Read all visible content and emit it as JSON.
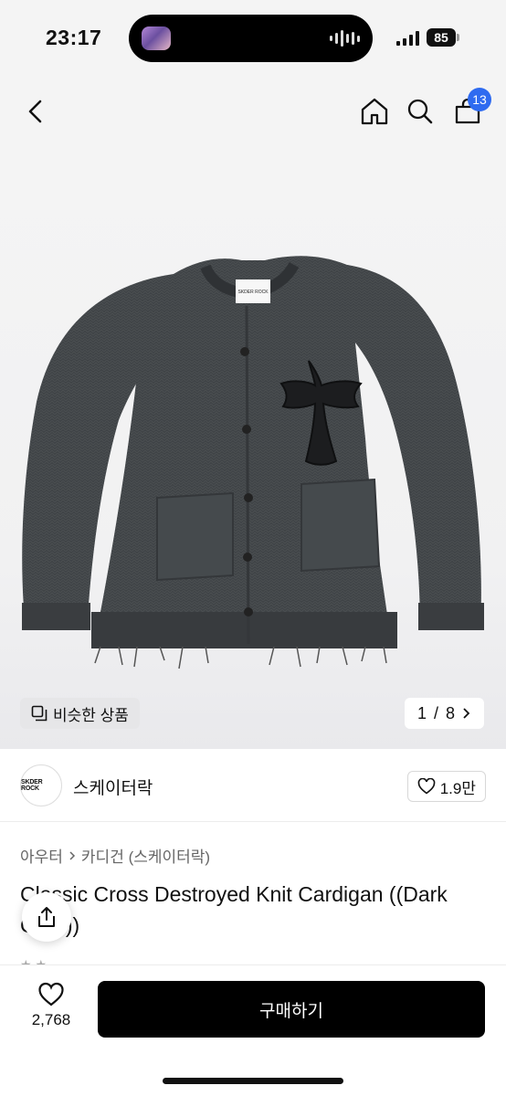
{
  "status_bar": {
    "time": "23:17",
    "battery": "85",
    "icons": [
      "now-playing-thumbnail-icon",
      "audio-wave-icon",
      "signal-icon",
      "battery-icon"
    ]
  },
  "nav": {
    "icons": [
      "back-icon",
      "home-icon",
      "search-icon",
      "cart-icon"
    ],
    "cart_count": "13"
  },
  "gallery": {
    "image_alt": "Dark gray distressed knit cardigan with black cross patch",
    "label_text": "SKDER ROCK",
    "similar_label": "비슷한 상품",
    "page_current": "1",
    "page_total": "8",
    "page_separator": "/"
  },
  "brand": {
    "logo_text": "SKDER ROCK",
    "name": "스케이터락",
    "likes": "1.9만"
  },
  "breadcrumb": {
    "category": "아우터",
    "subcategory": "카디건 (스케이터락)"
  },
  "product": {
    "title": "Classic Cross Destroyed Knit Cardigan ((Dark Gray))"
  },
  "bottom_bar": {
    "wish_count": "2,768",
    "buy_label": "구매하기"
  },
  "colors": {
    "accent_badge": "#2f6bf0",
    "buy_button": "#000000",
    "hero_bg": "#f4f4f4",
    "garment": "#3f4346"
  }
}
